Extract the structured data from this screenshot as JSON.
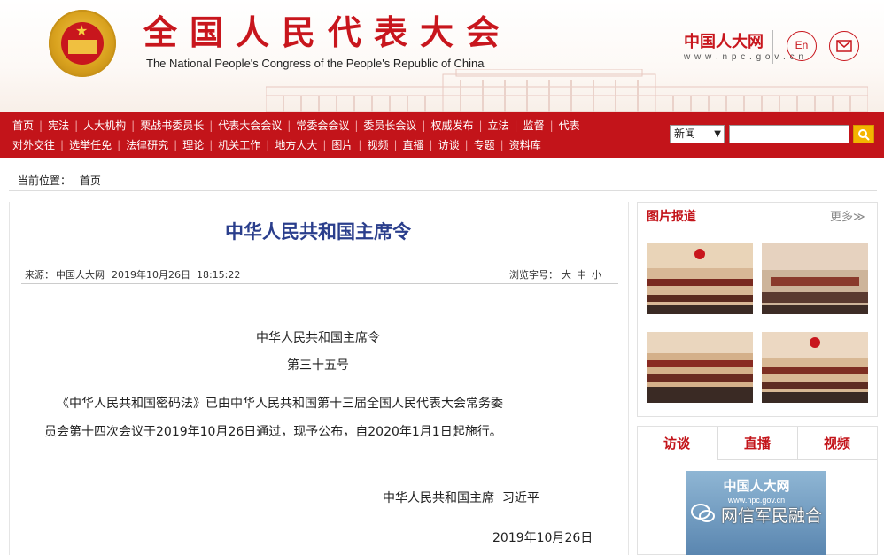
{
  "header": {
    "title": "全国人民代表大会",
    "subtitle": "The National People's Congress of the People's Republic of China",
    "logo_text": "中国人大网",
    "logo_url": "w w w . n p c . g o v . c n",
    "lang_button": "En",
    "mail_icon": "mail-icon",
    "emblem_icon": "national-emblem"
  },
  "nav": {
    "row1": [
      "首页",
      "宪法",
      "人大机构",
      "栗战书委员长",
      "代表大会会议",
      "常委会会议",
      "委员长会议",
      "权威发布",
      "立法",
      "监督",
      "代表"
    ],
    "row2": [
      "对外交往",
      "选举任免",
      "法律研究",
      "理论",
      "机关工作",
      "地方人大",
      "图片",
      "视频",
      "直播",
      "访谈",
      "专题",
      "资料库"
    ]
  },
  "search": {
    "select_value": "新闻",
    "input_value": "",
    "button_icon": "search-icon"
  },
  "breadcrumb": {
    "label": "当前位置：",
    "home": "首页"
  },
  "article": {
    "title": "中华人民共和国主席令",
    "source_label": "来源：",
    "source": "中国人大网",
    "datetime": "2019年10月26日  18:15:22",
    "fontsize_label": "浏览字号：",
    "fontsizes": [
      "大",
      "中",
      "小"
    ],
    "heading1": "中华人民共和国主席令",
    "heading2": "第三十五号",
    "body_line1": "《中华人民共和国密码法》已由中华人民共和国第十三届全国人民代表大会常务委",
    "body_line2": "员会第十四次会议于2019年10月26日通过，现予公布，自2020年1月1日起施行。",
    "signature": "中华人民共和国主席  习近平",
    "date": "2019年10月26日"
  },
  "sidebar": {
    "photo_heading": "图片报道",
    "more": "更多≫",
    "tabs": [
      "访谈",
      "直播",
      "视频"
    ],
    "interview_title": "中国人大网",
    "interview_url": "www.npc.gov.cn"
  },
  "watermark": {
    "text": "网信军民融合",
    "icon": "wechat-icon"
  },
  "colors": {
    "brand_red": "#c3141a",
    "title_blue": "#2a3e8c",
    "search_yellow": "#f4b400"
  }
}
